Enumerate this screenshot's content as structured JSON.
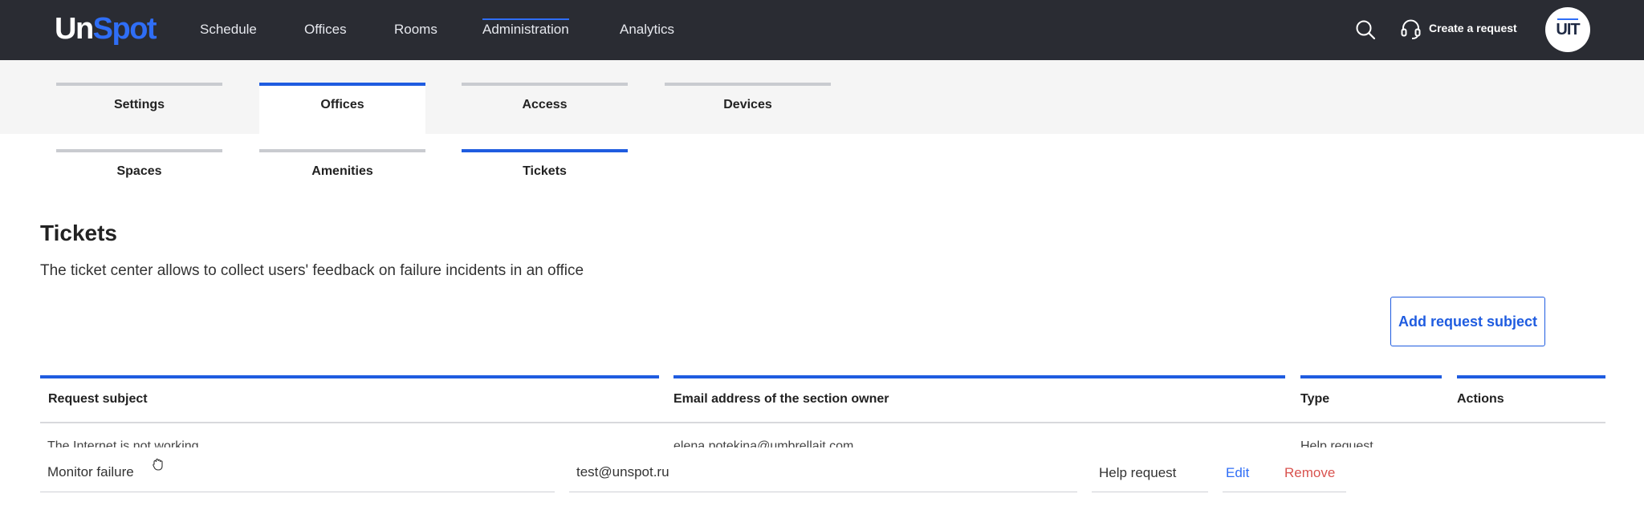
{
  "brand": {
    "part1": "Un",
    "part2": "Spot",
    "accent": "#2f6ef6"
  },
  "nav": [
    {
      "label": "Schedule",
      "active": false
    },
    {
      "label": "Offices",
      "active": false
    },
    {
      "label": "Rooms",
      "active": false
    },
    {
      "label": "Administration",
      "active": true
    },
    {
      "label": "Analytics",
      "active": false
    }
  ],
  "header": {
    "create_request": "Create a request",
    "avatar_initials": "UIT",
    "search_icon": "search-icon",
    "headset_icon": "headset-icon"
  },
  "tabs": [
    {
      "label": "Settings",
      "active": false
    },
    {
      "label": "Offices",
      "active": true
    },
    {
      "label": "Access",
      "active": false
    },
    {
      "label": "Devices",
      "active": false
    }
  ],
  "subtabs": [
    {
      "label": "Spaces",
      "active": false
    },
    {
      "label": "Amenities",
      "active": false
    },
    {
      "label": "Tickets",
      "active": true
    }
  ],
  "page": {
    "title": "Tickets",
    "description": "The ticket center allows to collect users' feedback on failure incidents in an office",
    "add_button": "Add request subject"
  },
  "table": {
    "columns": [
      "Request subject",
      "Email address of the section owner",
      "Type",
      "Actions"
    ],
    "rows": [
      {
        "subject": "The Internet is not working",
        "email": "elena.potekina@umbrellait.com",
        "type": "Help request"
      }
    ],
    "editing_row": {
      "subject": "Monitor failure",
      "email": "test@unspot.ru",
      "type": "Help request",
      "edit": "Edit",
      "remove": "Remove"
    }
  },
  "colors": {
    "topbar": "#2a2c33",
    "primary": "#1f5ce0",
    "danger": "#d9534f"
  }
}
